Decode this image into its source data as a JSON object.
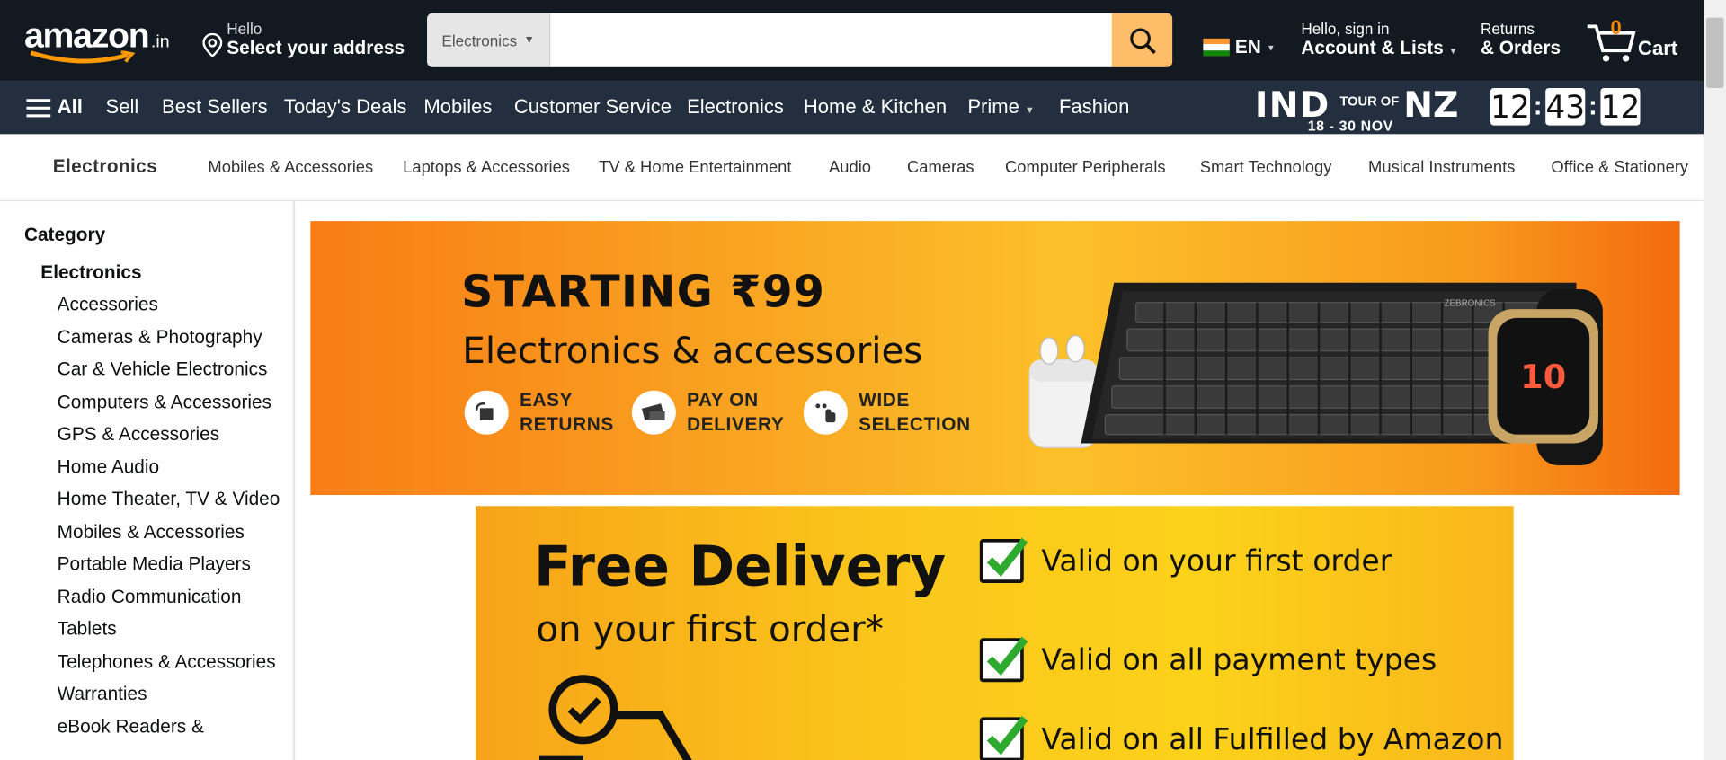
{
  "header": {
    "logo": "amazon",
    "logo_suffix": ".in",
    "address_hello": "Hello",
    "address_select": "Select your address",
    "search_category": "Electronics",
    "search_placeholder": "",
    "language": "EN",
    "account_line1": "Hello, sign in",
    "account_line2": "Account & Lists",
    "returns_line1": "Returns",
    "returns_line2": "& Orders",
    "cart_count": "0",
    "cart_label": "Cart"
  },
  "nav": {
    "all_label": "All",
    "items": [
      "Sell",
      "Best Sellers",
      "Today's Deals",
      "Mobiles",
      "Customer Service",
      "Electronics",
      "Home & Kitchen",
      "Prime",
      "Fashion"
    ],
    "promo_team1": "IND",
    "promo_tour": "TOUR OF",
    "promo_team2": "NZ",
    "promo_dates": "18 - 30 NOV",
    "timer": [
      "12",
      "43",
      "12"
    ]
  },
  "subnav": {
    "title": "Electronics",
    "links": [
      "Mobiles & Accessories",
      "Laptops & Accessories",
      "TV & Home Entertainment",
      "Audio",
      "Cameras",
      "Computer Peripherals",
      "Smart Technology",
      "Musical Instruments",
      "Office & Stationery"
    ]
  },
  "sidebar": {
    "heading": "Category",
    "root": "Electronics",
    "items": [
      "Accessories",
      "Cameras & Photography",
      "Car & Vehicle Electronics",
      "Computers & Accessories",
      "GPS & Accessories",
      "Home Audio",
      "Home Theater, TV & Video",
      "Mobiles & Accessories",
      "Portable Media Players",
      "Radio Communication",
      "Tablets",
      "Telephones & Accessories",
      "Warranties",
      "eBook Readers &"
    ]
  },
  "banner1": {
    "headline": "STARTING ₹99",
    "subhead": "Electronics & accessories",
    "features": [
      {
        "line1": "EASY",
        "line2": "RETURNS",
        "icon": "box-return-icon"
      },
      {
        "line1": "PAY ON",
        "line2": "DELIVERY",
        "icon": "cash-icon"
      },
      {
        "line1": "WIDE",
        "line2": "SELECTION",
        "icon": "hand-select-icon"
      }
    ],
    "keyboard_brand": "ZEBRONICS"
  },
  "banner2": {
    "headline": "Free Delivery",
    "subhead": "on your first order*",
    "checks": [
      "Valid on your first order",
      "Valid on all payment types",
      "Valid on all Fulfilled by Amazon"
    ]
  },
  "colors": {
    "header_bg": "#131921",
    "nav_bg": "#232f3e",
    "accent": "#febd69",
    "cart_orange": "#f08804",
    "check_green": "#2eaa2e"
  }
}
